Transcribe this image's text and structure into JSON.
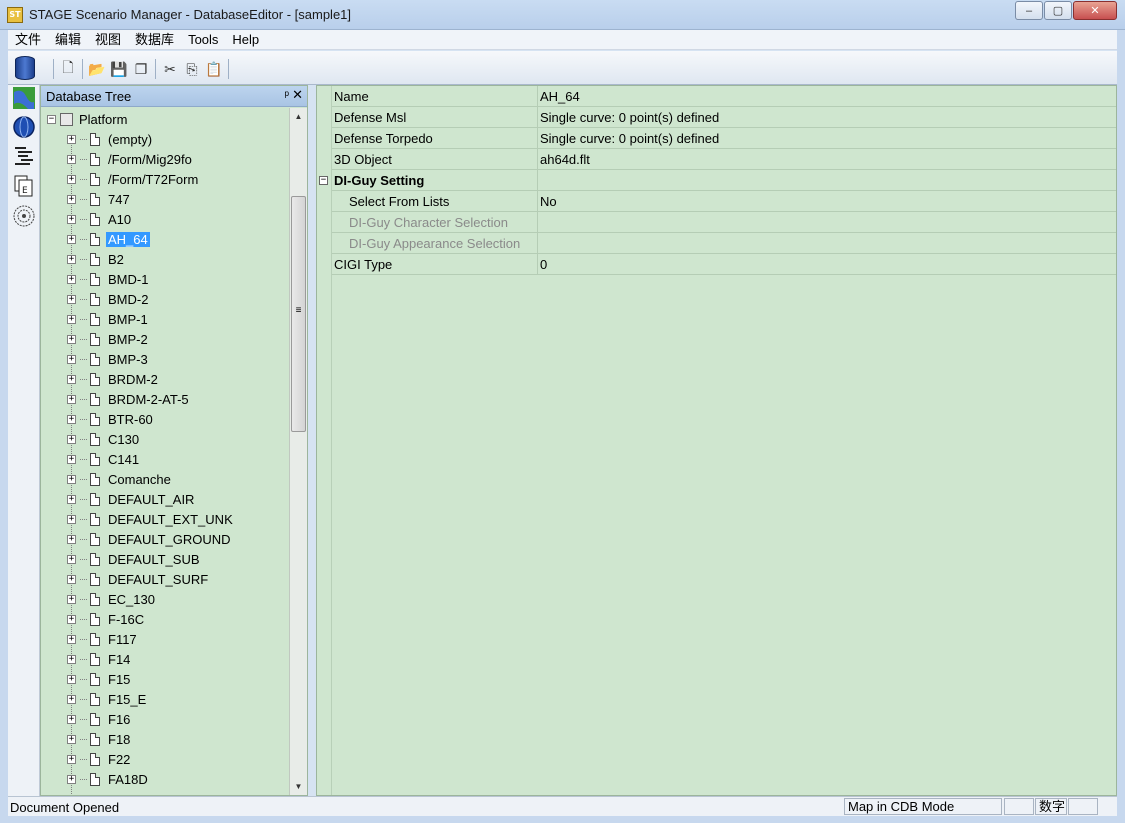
{
  "window": {
    "title": "STAGE Scenario Manager - DatabaseEditor - [sample1]",
    "app_icon_text": "ST",
    "minimize": "–",
    "maximize": "▢",
    "close": "✕"
  },
  "menu": [
    "文件",
    "编辑",
    "视图",
    "数据库",
    "Tools",
    "Help"
  ],
  "toolbar": {
    "buttons": [
      {
        "icon": "new-document-icon",
        "glyph": "🗋"
      },
      {
        "icon": "open-folder-icon",
        "glyph": "📂"
      },
      {
        "icon": "save-icon",
        "glyph": "💾"
      },
      {
        "icon": "save-all-icon",
        "glyph": "❐"
      },
      {
        "icon": "cut-icon",
        "glyph": "✂"
      },
      {
        "icon": "copy-icon",
        "glyph": "⎘"
      },
      {
        "icon": "paste-icon",
        "glyph": "📋"
      }
    ]
  },
  "tree_panel": {
    "title": "Database Tree",
    "pin": "📌",
    "close": "✕",
    "root": "Platform",
    "selected": "AH_64",
    "items": [
      "(empty)",
      "/Form/Mig29fo",
      "/Form/T72Form",
      "747",
      "A10",
      "AH_64",
      "B2",
      "BMD-1",
      "BMD-2",
      "BMP-1",
      "BMP-2",
      "BMP-3",
      "BRDM-2",
      "BRDM-2-AT-5",
      "BTR-60",
      "C130",
      "C141",
      "Comanche",
      "DEFAULT_AIR",
      "DEFAULT_EXT_UNK",
      "DEFAULT_GROUND",
      "DEFAULT_SUB",
      "DEFAULT_SURF",
      "EC_130",
      "F-16C",
      "F117",
      "F14",
      "F15",
      "F15_E",
      "F16",
      "F18",
      "F22",
      "FA18D"
    ],
    "scroll_up": "▲",
    "scroll_down": "▼",
    "scroll_grip": "≡"
  },
  "properties": [
    {
      "name": "Name",
      "value": "AH_64",
      "kind": "normal"
    },
    {
      "name": "Defense Msl",
      "value": "Single curve: 0 point(s) defined",
      "kind": "normal"
    },
    {
      "name": "Defense Torpedo",
      "value": "Single curve: 0 point(s) defined",
      "kind": "normal"
    },
    {
      "name": "3D Object",
      "value": "ah64d.flt",
      "kind": "normal"
    },
    {
      "name": "DI-Guy Setting",
      "value": "",
      "kind": "category",
      "toggle": "−"
    },
    {
      "name": "Select From Lists",
      "value": "No",
      "kind": "child"
    },
    {
      "name": "DI-Guy Character Selection",
      "value": "",
      "kind": "disabled"
    },
    {
      "name": "DI-Guy Appearance Selection",
      "value": "",
      "kind": "disabled"
    },
    {
      "name": "CIGI Type",
      "value": "0",
      "kind": "normal"
    }
  ],
  "statusbar": {
    "message": "Document Opened",
    "mode": "Map in CDB Mode",
    "num": "数字"
  },
  "colors": {
    "panel_bg": "#cfe6cf",
    "selection": "#3399ff",
    "header": "#a9c4e4"
  }
}
